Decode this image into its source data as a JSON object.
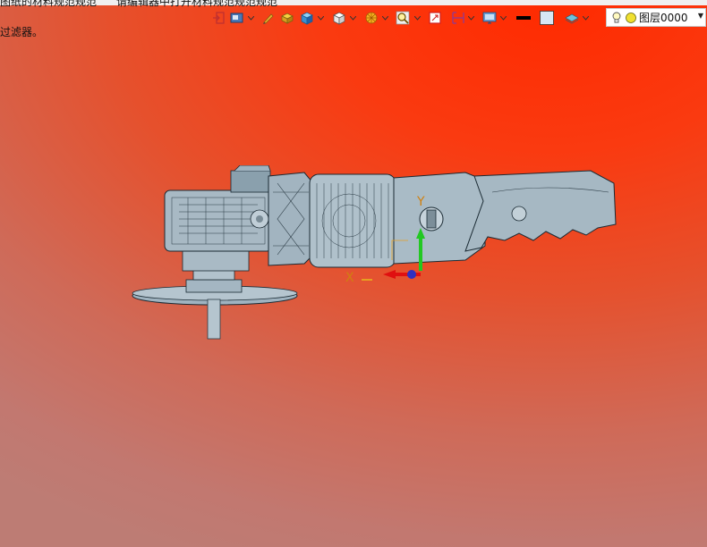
{
  "window": {
    "top_text_left": "图纸的材料规范规范",
    "top_text_right": "请编辑器中打开材料规范规范规范"
  },
  "status": {
    "filter_hint": "过滤器。"
  },
  "toolbar": {
    "icons": [
      "exit-icon",
      "view-icon",
      "pen-icon",
      "box-yellow-icon",
      "cube-blue-icon",
      "cube-white-icon",
      "render-icon",
      "zoom-icon",
      "red-frame-icon",
      "section-icon",
      "display-icon",
      "line-color-icon",
      "fill-color-icon",
      "layer-stack-icon"
    ]
  },
  "layer": {
    "name": "图层0000"
  },
  "axis": {
    "x_label": "X",
    "y_label": "Y"
  },
  "colors": {
    "accent_green": "#22c822",
    "accent_red": "#e01010",
    "model_fill": "#a8b9c4"
  }
}
